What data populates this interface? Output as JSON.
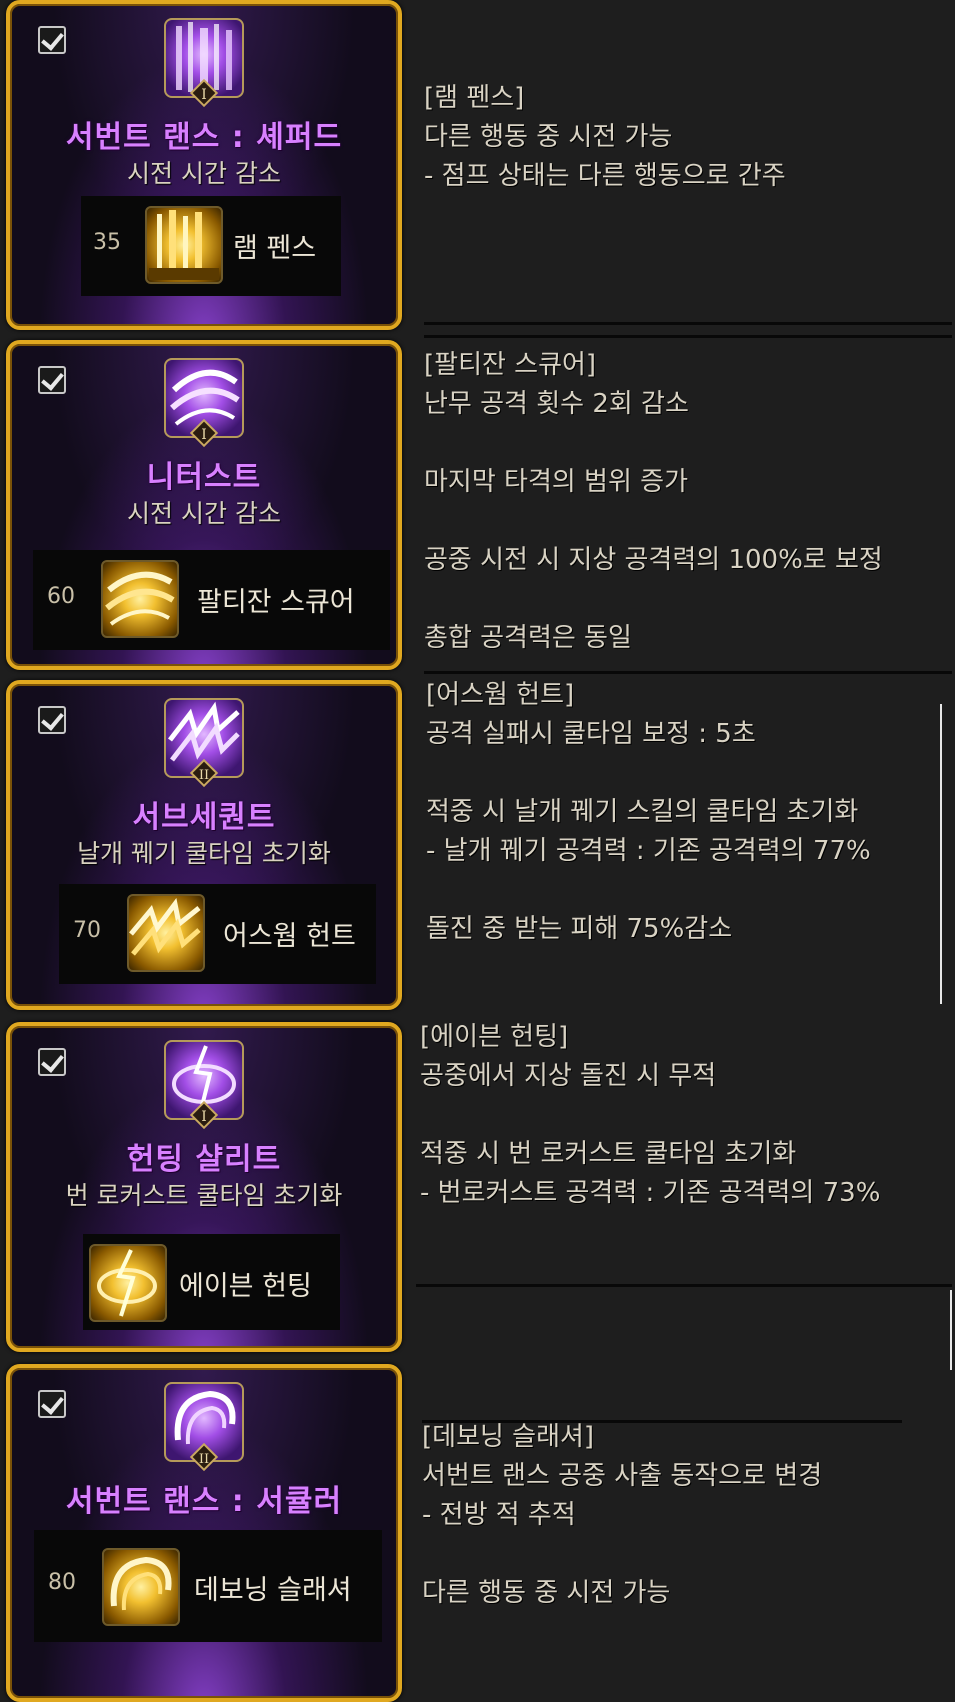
{
  "cards": [
    {
      "skill_name": "서번트 랜스 : 셰퍼드",
      "skill_sub": "시전 시간 감소",
      "tier": "I",
      "req_level": "35",
      "req_skill": "램 펜스",
      "icon": "lance-pillar-icon",
      "req_icon": "lance-fence-icon",
      "description": "[램 펜스]\n다른 행동 중 시전 가능\n- 점프 상태는 다른 행동으로 간주"
    },
    {
      "skill_name": "니터스트",
      "skill_sub": "시전 시간 감소",
      "tier": "I",
      "req_level": "60",
      "req_skill": "팔티잔 스큐어",
      "icon": "swirl-slash-icon",
      "req_icon": "swirl-slash-icon",
      "description": "[팔티잔 스큐어]\n난무 공격 횟수 2회 감소\n\n마지막 타격의 범위 증가\n\n공중 시전 시 지상 공격력의 100%로 보정\n\n총합 공격력은 동일"
    },
    {
      "skill_name": "서브세퀀트",
      "skill_sub": "날개 꿰기 쿨타임 초기화",
      "tier": "II",
      "req_level": "70",
      "req_skill": "어스웜 헌트",
      "icon": "earthworm-strike-icon",
      "req_icon": "earthworm-strike-icon",
      "description": "[어스웜 헌트]\n공격 실패시 쿨타임 보정 : 5초\n\n적중 시 날개 꿰기 스킬의 쿨타임 초기화\n- 날개 꿰기 공격력 : 기존 공격력의 77%\n\n돌진 중 받는 피해 75%감소"
    },
    {
      "skill_name": "헌팅 샬리트",
      "skill_sub": "번 로커스트 쿨타임 초기화",
      "tier": "I",
      "req_level": "",
      "req_skill": "에이븐 헌팅",
      "icon": "lightning-orb-icon",
      "req_icon": "lightning-orb-icon",
      "description": "[에이븐 헌팅]\n공중에서 지상 돌진 시 무적\n\n적중 시 번 로커스트 쿨타임 초기화\n- 번로커스트 공격력 : 기존 공격력의 73%"
    },
    {
      "skill_name": "서번트 랜스 : 서큘러",
      "skill_sub": "",
      "tier": "II",
      "req_level": "80",
      "req_skill": "데보닝 슬래셔",
      "icon": "circular-slash-icon",
      "req_icon": "circular-slash-icon",
      "description": "[데보닝 슬래셔]\n서번트 랜스 공중 사출 동작으로 변경\n- 전방 적 추적\n\n다른 행동 중 시전 가능"
    }
  ],
  "colors": {
    "frame": "#e0a820",
    "skill_name": "#d880ff",
    "text": "#d9d3c4",
    "background": "#1e1e1e"
  }
}
